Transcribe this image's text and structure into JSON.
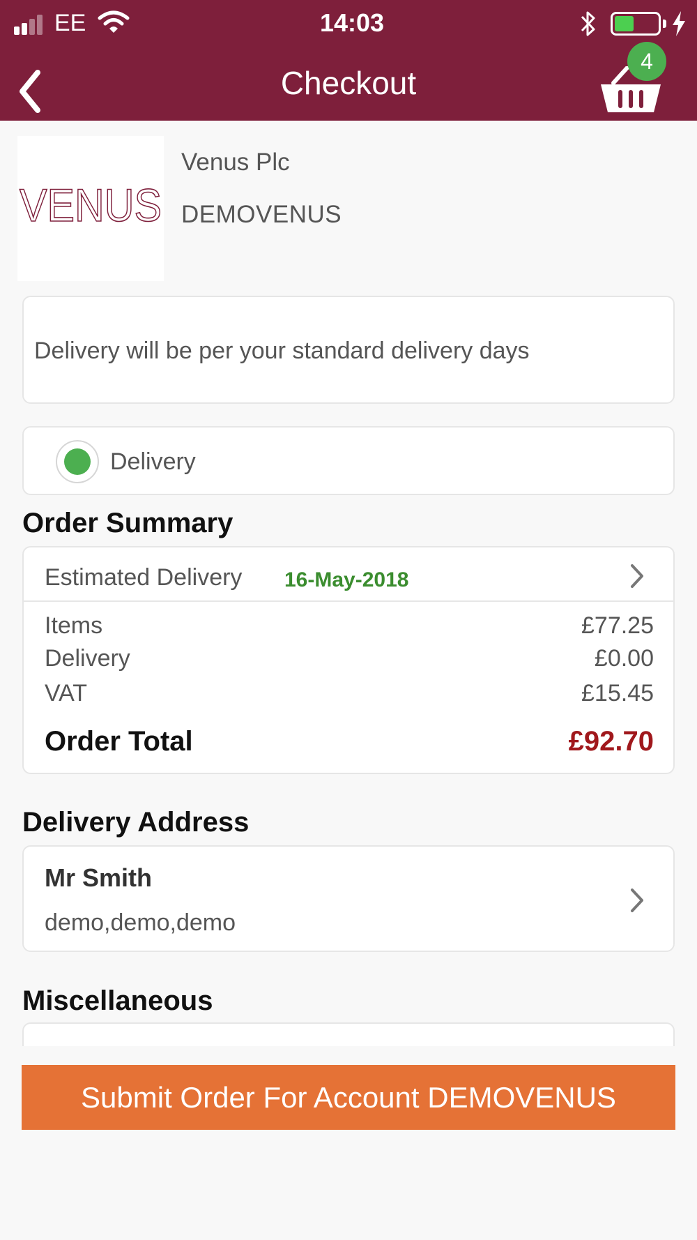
{
  "status_bar": {
    "carrier": "EE",
    "time": "14:03",
    "battery_level": 0.45
  },
  "header": {
    "title": "Checkout",
    "basket_count": "4"
  },
  "merchant": {
    "logo_text": "VENUS",
    "name": "Venus Plc",
    "account": "DEMOVENUS"
  },
  "delivery_note": "Delivery will be per your standard delivery days",
  "delivery_method": {
    "label": "Delivery",
    "selected": true
  },
  "order_summary": {
    "title": "Order Summary",
    "estimated_delivery_label": "Estimated Delivery",
    "estimated_delivery_date": "16-May-2018",
    "lines": [
      {
        "label": "Items",
        "value": "£77.25"
      },
      {
        "label": "Delivery",
        "value": "£0.00"
      },
      {
        "label": "VAT",
        "value": "£15.45"
      }
    ],
    "total_label": "Order Total",
    "total_value": "£92.70"
  },
  "delivery_address": {
    "title": "Delivery Address",
    "name": "Mr Smith",
    "lines": "demo,demo,demo"
  },
  "miscellaneous": {
    "title": "Miscellaneous"
  },
  "submit_label": "Submit Order For Account DEMOVENUS",
  "colors": {
    "header": "#7e1f3b",
    "accent_green": "#4caf50",
    "submit": "#e57236",
    "total": "#a0181c"
  },
  "icons": [
    "signal-icon",
    "wifi-icon",
    "bluetooth-icon",
    "battery-icon",
    "charging-icon",
    "back-chevron-icon",
    "basket-icon",
    "chevron-right-icon"
  ]
}
